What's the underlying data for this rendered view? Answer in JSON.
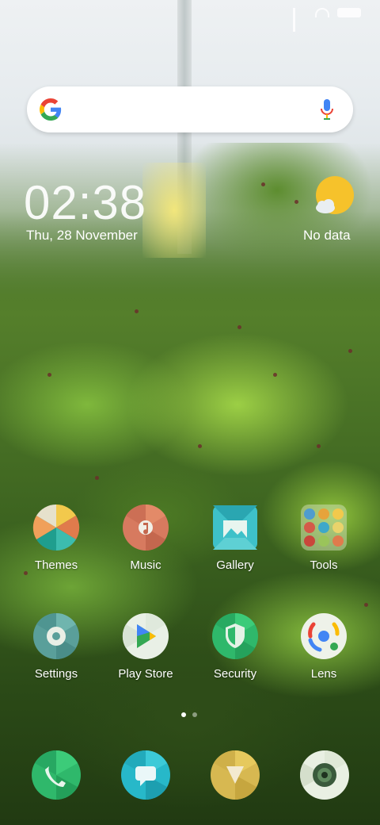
{
  "clock": {
    "time": "02:38",
    "date": "Thu, 28 November"
  },
  "weather": {
    "status": "No data"
  },
  "apps": [
    {
      "label": "Themes"
    },
    {
      "label": "Music"
    },
    {
      "label": "Gallery"
    },
    {
      "label": "Tools"
    },
    {
      "label": "Settings"
    },
    {
      "label": "Play Store"
    },
    {
      "label": "Security"
    },
    {
      "label": "Lens"
    }
  ],
  "dock": [
    {
      "icon": "phone-icon"
    },
    {
      "icon": "messages-icon"
    },
    {
      "icon": "browser-icon"
    },
    {
      "icon": "camera-icon"
    }
  ],
  "page_indicator": {
    "pages": 2,
    "current": 1
  },
  "colors": {
    "search_bg": "#ffffff",
    "weather_sun": "#f6c22b",
    "text": "#ffffff"
  }
}
